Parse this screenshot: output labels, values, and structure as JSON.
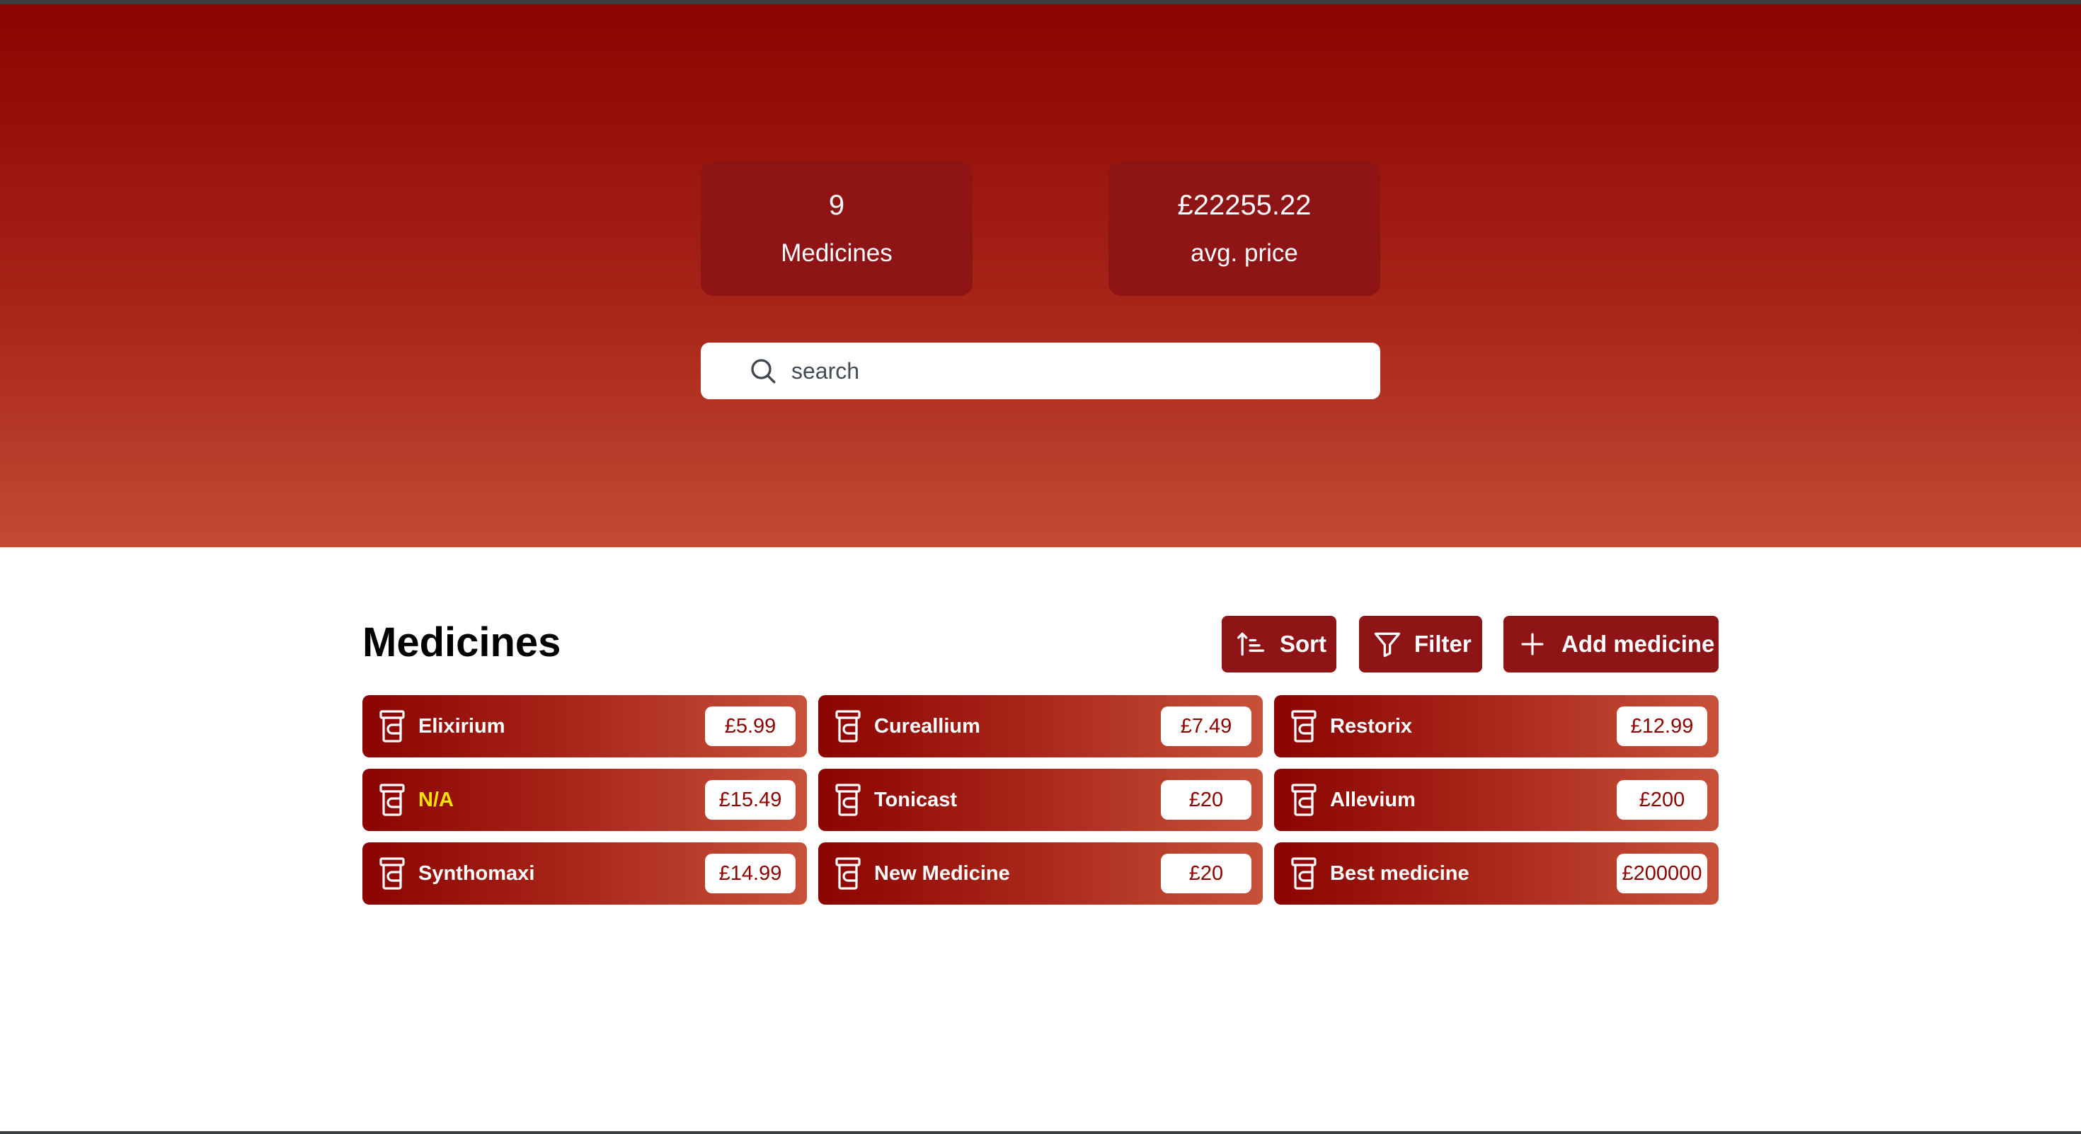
{
  "stats": {
    "count_value": "9",
    "count_label": "Medicines",
    "avg_value": "£22255.22",
    "avg_label": "avg. price"
  },
  "search": {
    "placeholder": "search",
    "value": ""
  },
  "section": {
    "title": "Medicines"
  },
  "actions": {
    "sort_label": "Sort",
    "filter_label": "Filter",
    "add_label": "Add medicine"
  },
  "medicines": [
    {
      "name": "Elixirium",
      "price": "£5.99"
    },
    {
      "name": "Cureallium",
      "price": "£7.49"
    },
    {
      "name": "Restorix",
      "price": "£12.99"
    },
    {
      "name": "N/A",
      "price": "£15.49"
    },
    {
      "name": "Tonicast",
      "price": "£20"
    },
    {
      "name": "Allevium",
      "price": "£200"
    },
    {
      "name": "Synthomaxi",
      "price": "£14.99"
    },
    {
      "name": "New Medicine",
      "price": "£20"
    },
    {
      "name": "Best medicine",
      "price": "£200000"
    }
  ],
  "icons": {
    "search": "search-icon",
    "sort": "sort-ascending-icon",
    "filter": "filter-icon",
    "add": "plus-icon",
    "medicine": "pill-bottle-icon"
  },
  "colors": {
    "hero_top": "#8b0402",
    "hero_bottom": "#c44a34",
    "card": "#8e1416",
    "warning_text": "#f7e300"
  }
}
